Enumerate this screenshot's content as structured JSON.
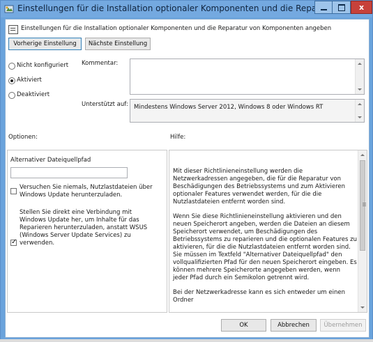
{
  "window": {
    "title": "Einstellungen für die Installation optionaler Komponenten und die Reparatur von K...",
    "close_glyph": "x",
    "colors": {
      "titlebar": "#74a9e0",
      "close": "#c7413a",
      "focus_border": "#3c7fb1"
    }
  },
  "header": {
    "text": "Einstellungen für die Installation optionaler Komponenten und die Reparatur von Komponenten angeben"
  },
  "nav": {
    "previous_label": "Vorherige Einstellung",
    "next_label": "Nächste Einstellung"
  },
  "state": {
    "options": [
      {
        "label": "Nicht konfiguriert",
        "selected": false
      },
      {
        "label": "Aktiviert",
        "selected": true
      },
      {
        "label": "Deaktiviert",
        "selected": false
      }
    ]
  },
  "comment": {
    "label": "Kommentar:",
    "value": ""
  },
  "supported": {
    "label": "Unterstützt auf:",
    "value": "Mindestens Windows Server 2012, Windows 8 oder Windows RT"
  },
  "options_panel": {
    "heading": "Optionen:",
    "path_label": "Alternativer Dateiquellpfad",
    "path_value": "",
    "checkbox_never_download": {
      "label": "Versuchen Sie niemals, Nutzlastdateien über Windows Update herunterzuladen.",
      "checked": false
    },
    "checkbox_direct_wu": {
      "label": "Stellen Sie direkt eine Verbindung mit Windows Update her, um Inhalte für das Reparieren herunterzuladen, anstatt WSUS (Windows Server Update Services) zu verwenden.",
      "checked": true
    }
  },
  "help_panel": {
    "heading": "Hilfe:",
    "paragraphs": [
      "Mit dieser Richtlinieneinstellung werden die Netzwerkadressen angegeben, die für die Reparatur von Beschädigungen des Betriebssystems und zum Aktivieren optionaler Features verwendet werden, für die die Nutzlastdateien entfernt worden sind.",
      "Wenn Sie diese Richtlinieneinstellung aktivieren und den neuen Speicherort angeben, werden die Dateien an diesem Speicherort verwendet, um Beschädigungen des Betriebssystems zu reparieren und die optionalen Features zu aktivieren, für die die Nutzlastdateien entfernt worden sind. Sie müssen im Textfeld \"Alternativer Dateiquellpfad\" den vollqualifizierten Pfad für den neuen Speicherort eingeben. Es können mehrere Speicherorte angegeben werden, wenn jeder Pfad durch ein Semikolon getrennt wird.",
      "Bei der Netzwerkadresse kann es sich entweder um einen Ordner"
    ]
  },
  "footer": {
    "ok_label": "OK",
    "cancel_label": "Abbrechen",
    "apply_label": "Übernehmen"
  }
}
